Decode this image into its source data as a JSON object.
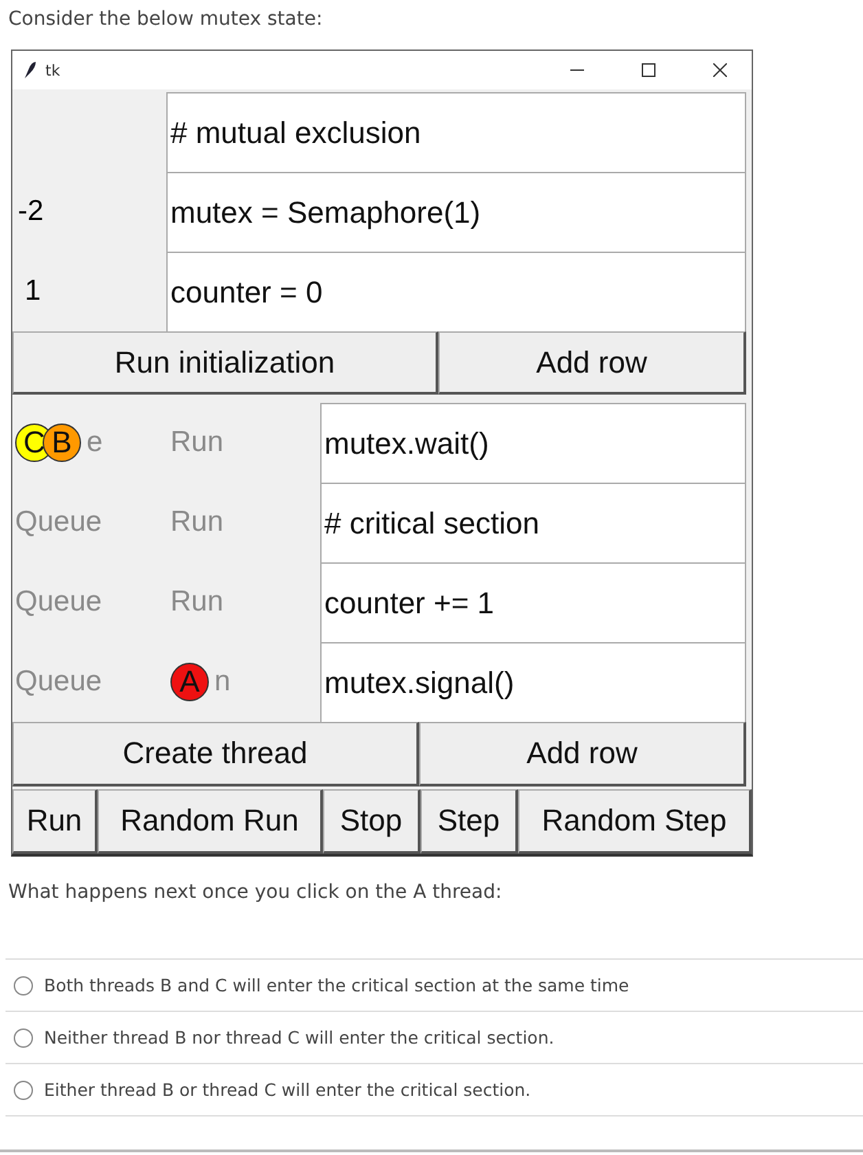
{
  "intro": "Consider the below mutex state:",
  "window": {
    "title": "tk"
  },
  "init_rows": [
    {
      "code": "# mutual exclusion"
    },
    {
      "value": "-2",
      "code": "mutex = Semaphore(1)"
    },
    {
      "value": "1",
      "code": "counter = 0"
    }
  ],
  "init_buttons": [
    "Run initialization",
    "Add row"
  ],
  "thread_rows": [
    {
      "queue_label": "e",
      "queue_tokens": [
        {
          "label": "C",
          "color": "#ffff00"
        },
        {
          "label": "B",
          "color": "#ff9900"
        }
      ],
      "run_label": "Run",
      "run_tokens": [],
      "code": "mutex.wait()"
    },
    {
      "queue_label": "Queue",
      "queue_tokens": [],
      "run_label": "Run",
      "run_tokens": [],
      "code": "# critical section"
    },
    {
      "queue_label": "Queue",
      "queue_tokens": [],
      "run_label": "Run",
      "run_tokens": [],
      "code": "counter += 1"
    },
    {
      "queue_label": "Queue",
      "queue_tokens": [],
      "run_label": "n",
      "run_tokens": [
        {
          "label": "A",
          "color": "#ee1111"
        }
      ],
      "code": "mutex.signal()"
    }
  ],
  "thread_buttons": [
    "Create thread",
    "Add row"
  ],
  "control_buttons": [
    "Run",
    "Random Run",
    "Stop",
    "Step",
    "Random Step"
  ],
  "question": "What happens next once you click on the A thread:",
  "options": [
    {
      "label": "Both threads B and C will enter the critical section at the same time",
      "selected": false
    },
    {
      "label": "Neither thread B nor thread C will enter the critical section.",
      "selected": false
    },
    {
      "label": "Either thread B or thread C will enter the critical section.",
      "selected": false
    }
  ]
}
